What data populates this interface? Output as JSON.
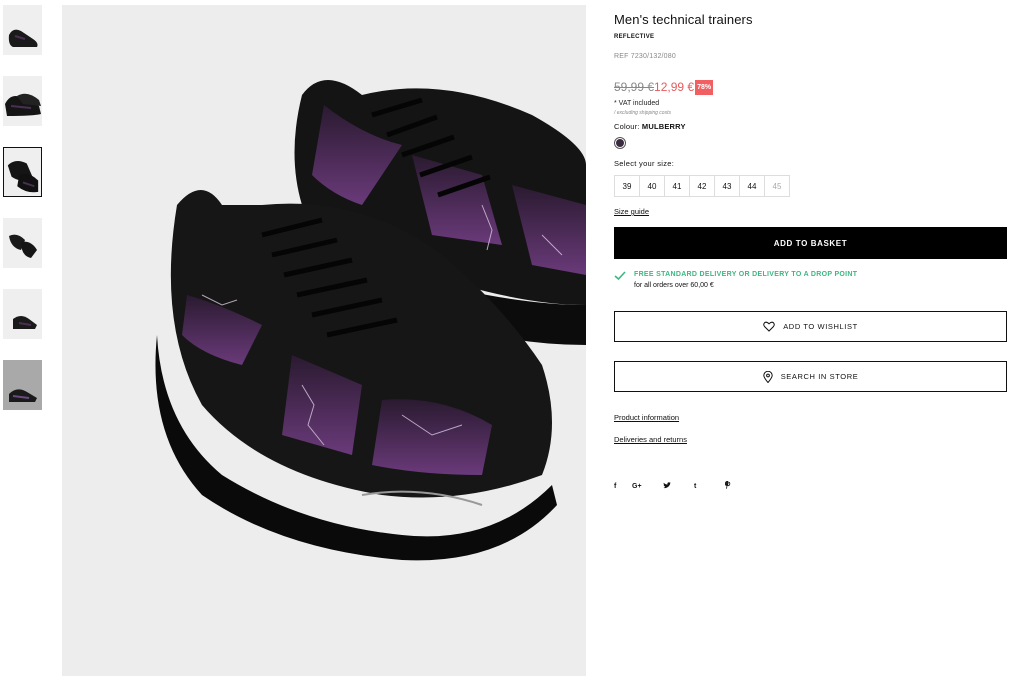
{
  "thumbnails": [
    {
      "name": "thumbnail-1"
    },
    {
      "name": "thumbnail-2"
    },
    {
      "name": "thumbnail-3",
      "active": true
    },
    {
      "name": "thumbnail-4"
    },
    {
      "name": "thumbnail-5"
    },
    {
      "name": "thumbnail-6"
    }
  ],
  "product": {
    "title": "Men's technical trainers",
    "tag": "REFLECTIVE",
    "ref": "REF 7230/132/080",
    "old_price": "59,99 €",
    "new_price": "12,99 €",
    "discount": "78%",
    "vat": "* VAT included",
    "shipping_note": "/ excluding shipping costs",
    "colour_label": "Colour:",
    "colour_value": "MULBERRY",
    "colour_swatch": "#3a2a40",
    "size_label": "Select your size:",
    "sizes": [
      "39",
      "40",
      "41",
      "42",
      "43",
      "44",
      "45"
    ],
    "size_guide": "Size guide",
    "add_to_basket": "ADD TO BASKET",
    "delivery_title": "FREE STANDARD DELIVERY OR DELIVERY TO A DROP POINT",
    "delivery_sub": "for all orders over 60,00 €",
    "wishlist": "ADD TO WISHLIST",
    "store": "SEARCH IN STORE",
    "product_info": "Product information",
    "deliveries": "Deliveries and returns"
  },
  "social": {
    "facebook": "f",
    "google": "G+",
    "tumblr": "t"
  },
  "colors": {
    "sale": "#e85a5a",
    "discount_bg": "#f15f63",
    "delivery_green": "#3cb882"
  }
}
